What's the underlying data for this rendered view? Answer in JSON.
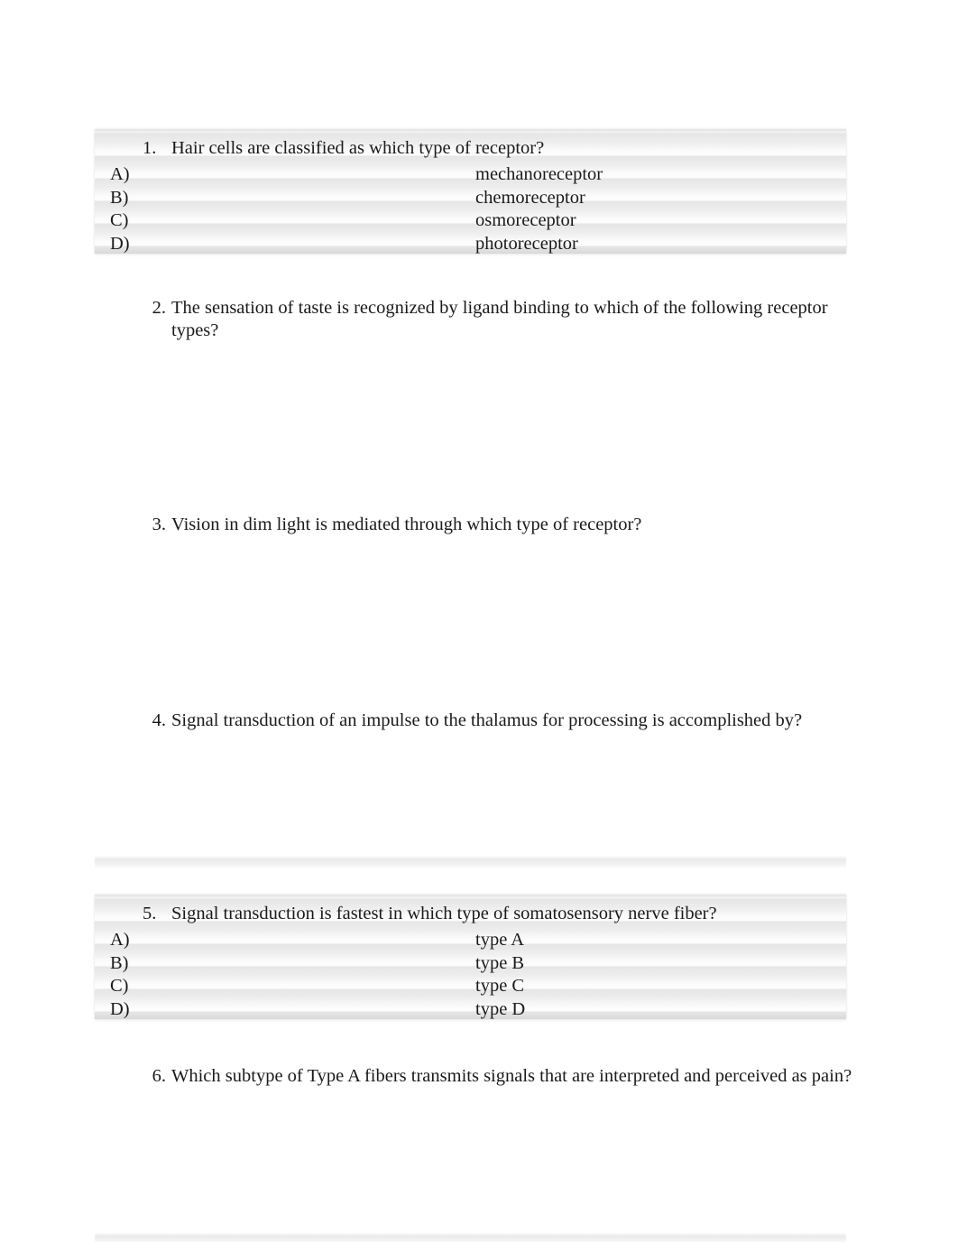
{
  "document": {
    "type": "multiple-choice-quiz",
    "page_background": "#ffffff",
    "text_color": "#1a1a1a",
    "shaded_block_color": "#efefef"
  },
  "questions": [
    {
      "number": "1.",
      "text": "Hair cells are classified as which type of receptor?",
      "shaded": true,
      "options": [
        {
          "letter": "A)",
          "text": "mechanoreceptor"
        },
        {
          "letter": "B)",
          "text": "chemoreceptor"
        },
        {
          "letter": "C)",
          "text": "osmoreceptor"
        },
        {
          "letter": "D)",
          "text": "photoreceptor"
        }
      ]
    },
    {
      "number": "2.",
      "text": "The sensation of taste is recognized by ligand binding to which of the following receptor types?",
      "shaded": false,
      "options": []
    },
    {
      "number": "3.",
      "text": "Vision in dim light is mediated through which type of receptor?",
      "shaded": false,
      "options": []
    },
    {
      "number": "4.",
      "text": "Signal transduction of an impulse to the thalamus for processing is accomplished by?",
      "shaded": false,
      "options": []
    },
    {
      "number": "5.",
      "text": "Signal transduction is fastest in which type of somatosensory nerve fiber?",
      "shaded": true,
      "options": [
        {
          "letter": "A)",
          "text": "type A"
        },
        {
          "letter": "B)",
          "text": "type B"
        },
        {
          "letter": "C)",
          "text": "type C"
        },
        {
          "letter": "D)",
          "text": "type D"
        }
      ]
    },
    {
      "number": "6.",
      "text": "Which subtype of Type A fibers transmits signals that are interpreted and perceived as pain?",
      "shaded": false,
      "options": []
    }
  ]
}
